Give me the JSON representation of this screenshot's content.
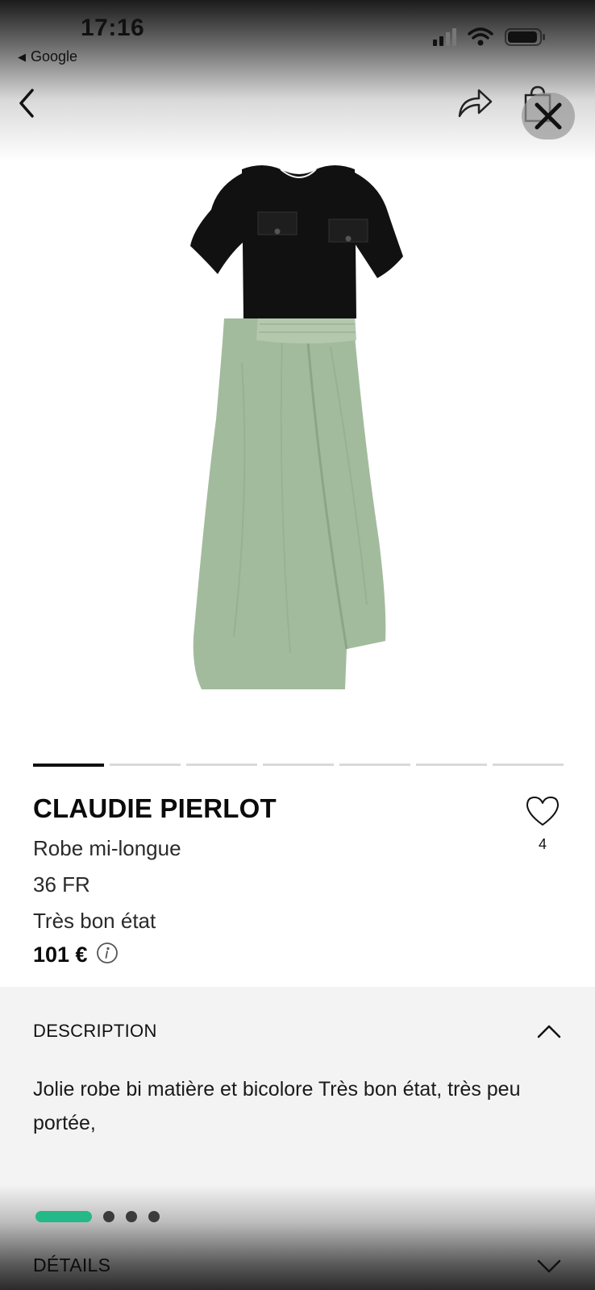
{
  "status_bar": {
    "time": "17:16",
    "back_app": "Google",
    "icons": [
      "signal-icon",
      "wifi-icon",
      "battery-icon"
    ]
  },
  "nav": {
    "icons": [
      "chevron-left-icon",
      "share-icon",
      "shopping-bag-icon",
      "close-icon"
    ]
  },
  "carousel": {
    "count": 7,
    "active_index": 0
  },
  "product": {
    "brand": "CLAUDIE PIERLOT",
    "type": "Robe mi-longue",
    "size": "36 FR",
    "condition": "Très bon état",
    "price": "101 €",
    "favorites_count": "4"
  },
  "description": {
    "title": "DESCRIPTION",
    "text": "Jolie robe bi matière et bicolore Très bon état, très peu portée,"
  },
  "pager": {
    "count": 4,
    "active_index": 0,
    "active_color": "#25b889"
  },
  "details": {
    "title": "DÉTAILS"
  },
  "colors": {
    "accent": "#25b889",
    "section_bg": "#f3f3f3",
    "dress_top": "#111111",
    "dress_skirt": "#9fb89a"
  }
}
